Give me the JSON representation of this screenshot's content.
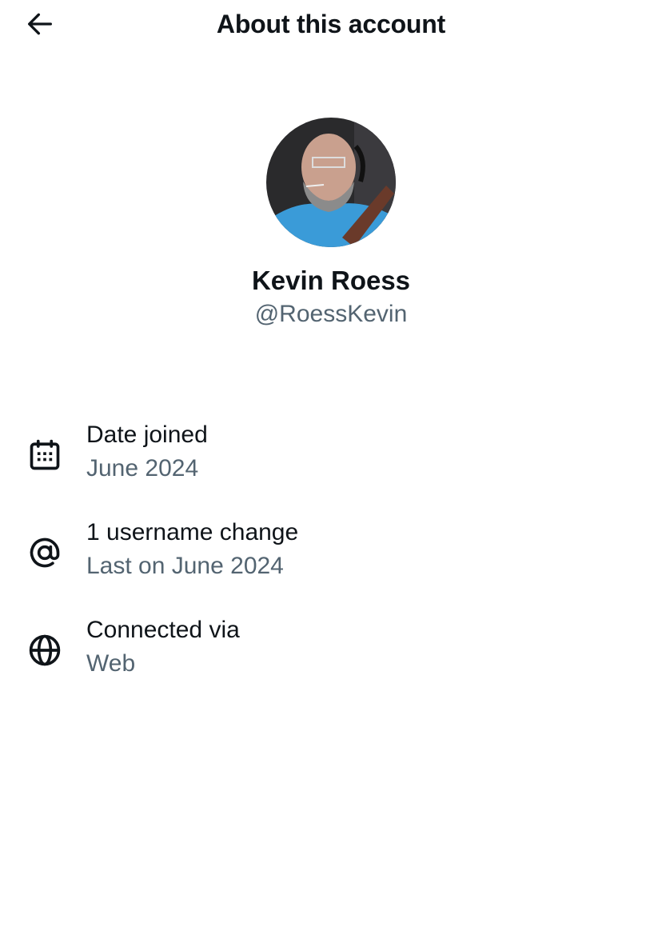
{
  "header": {
    "back_icon": "arrow-left-icon",
    "title": "About this account"
  },
  "profile": {
    "avatar": "profile-photo",
    "name": "Kevin Roess",
    "handle": "@RoessKevin"
  },
  "info": [
    {
      "icon": "calendar-icon",
      "label": "Date joined",
      "value": "June 2024"
    },
    {
      "icon": "at-sign-icon",
      "label": "1 username change",
      "value": "Last on June 2024"
    },
    {
      "icon": "globe-icon",
      "label": "Connected via",
      "value": "Web"
    }
  ],
  "colors": {
    "text_primary": "#0f1419",
    "text_secondary": "#536471",
    "background": "#ffffff"
  }
}
